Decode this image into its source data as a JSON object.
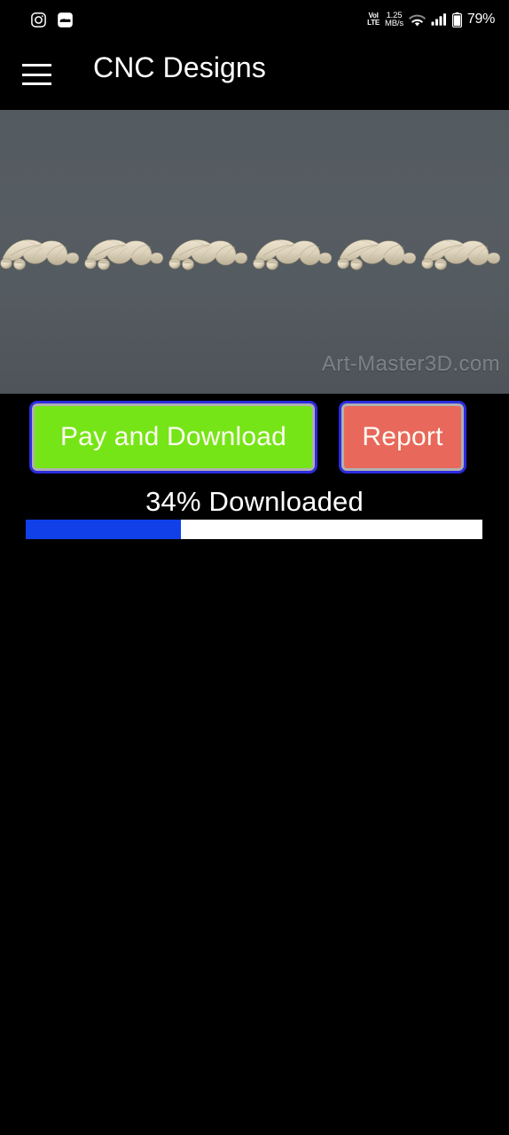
{
  "status_bar": {
    "left_icons": [
      {
        "name": "instagram-icon",
        "label": "Instagram"
      },
      {
        "name": "notification-icon",
        "label": "Notification"
      }
    ],
    "volte_top": "VoI",
    "volte_bottom": "LTE",
    "net_speed_value": "1.25",
    "net_speed_unit": "MB/s",
    "wifi_icon": "wifi-icon",
    "signal_icon": "signal-bars-icon",
    "battery_icon": "battery-icon",
    "battery_percent": "79%"
  },
  "app_bar": {
    "menu_icon": "hamburger-menu-icon",
    "title": "CNC Designs"
  },
  "preview": {
    "alt": "Oak leaf and acorn carved molding design",
    "watermark": "Art-Master3D.com",
    "background_color": "#555c61",
    "carving_color": "#ded5c0"
  },
  "actions": {
    "pay_label": "Pay and Download",
    "pay_fill": "#76e517",
    "report_label": "Report",
    "report_fill": "#e8685c",
    "border_color": "#2c2ce0"
  },
  "progress": {
    "label": "34% Downloaded",
    "percent": 34,
    "fill_color": "#1140e8",
    "track_color": "#ffffff"
  }
}
